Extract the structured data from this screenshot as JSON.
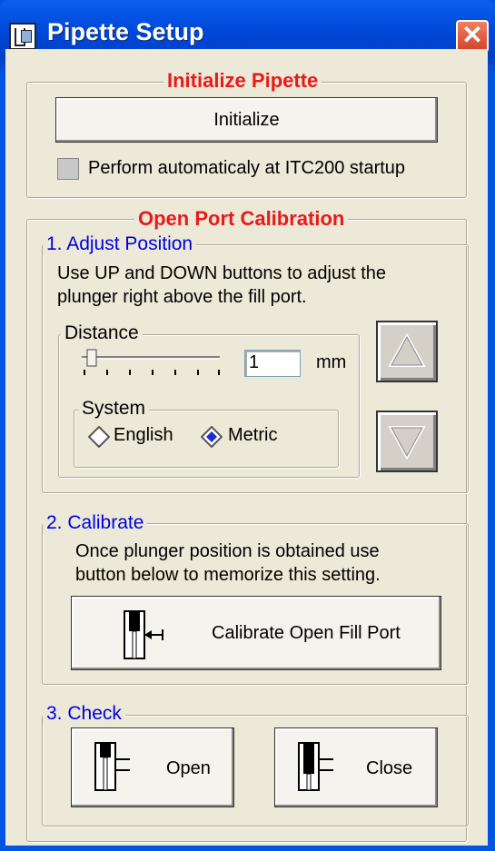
{
  "window": {
    "title": "Pipette Setup",
    "close_label": "✕"
  },
  "init": {
    "legend": "Initialize Pipette",
    "button_label": "Initialize",
    "auto_label": "Perform automaticaly at ITC200 startup"
  },
  "calib": {
    "legend": "Open Port Calibration",
    "adjust": {
      "legend": "1. Adjust Position",
      "instructions_line1": "Use UP and DOWN buttons to adjust the",
      "instructions_line2": "plunger right above the fill port.",
      "distance_legend": "Distance",
      "distance_value": "1",
      "distance_unit": "mm",
      "system_legend": "System",
      "system_options": [
        "English",
        "Metric"
      ],
      "system_selected": "Metric",
      "up_icon": "up-triangle-icon",
      "down_icon": "down-triangle-icon"
    },
    "calibrate": {
      "legend": "2. Calibrate",
      "instructions_line1": "Once plunger position is obtained use",
      "instructions_line2": "button below to memorize this setting.",
      "button_label": "Calibrate Open Fill Port",
      "button_icon": "plunger-arrow-icon"
    },
    "check": {
      "legend": "3. Check",
      "open_label": "Open",
      "close_label": "Close",
      "open_icon": "valve-open-icon",
      "close_icon": "valve-close-icon"
    }
  },
  "colors": {
    "title_bar": "#0047d6",
    "legend_red": "#e81a1a",
    "legend_blue": "#0000e0",
    "dialog_bg": "#ece9d8"
  }
}
